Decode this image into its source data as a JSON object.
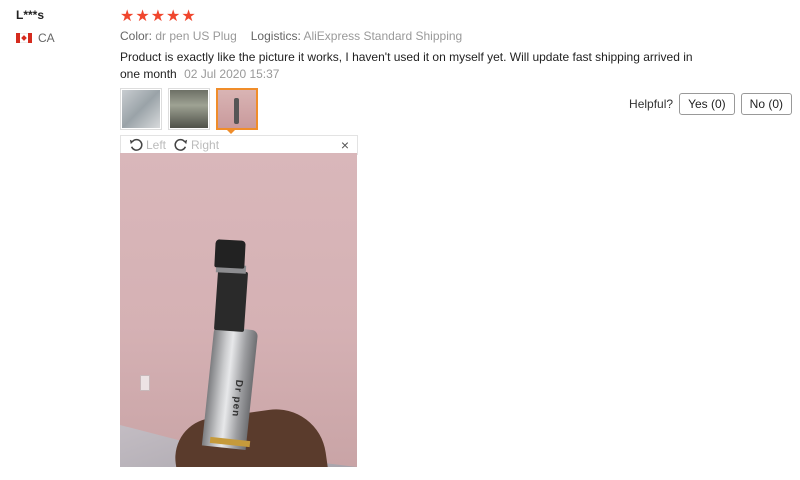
{
  "review": {
    "user": "L***s",
    "country": "CA",
    "rating": 5,
    "stars": [
      "★",
      "★",
      "★",
      "★",
      "★"
    ],
    "color_label": "Color:",
    "color_value": "dr pen US Plug",
    "logistics_label": "Logistics:",
    "logistics_value": "AliExpress Standard Shipping",
    "text": "Product is exactly like the picture it works, I haven't used it on myself yet. Will update fast shipping arrived in one month",
    "date": "02 Jul 2020 15:37",
    "photo_text": "Dr pen"
  },
  "helpful": {
    "label": "Helpful?",
    "yes": "Yes (0)",
    "no": "No (0)"
  },
  "viewer": {
    "rotate_left": "Left",
    "rotate_right": "Right",
    "close": "×"
  },
  "colors": {
    "star": "#f0462d",
    "active_thumb": "#f08d2a"
  }
}
